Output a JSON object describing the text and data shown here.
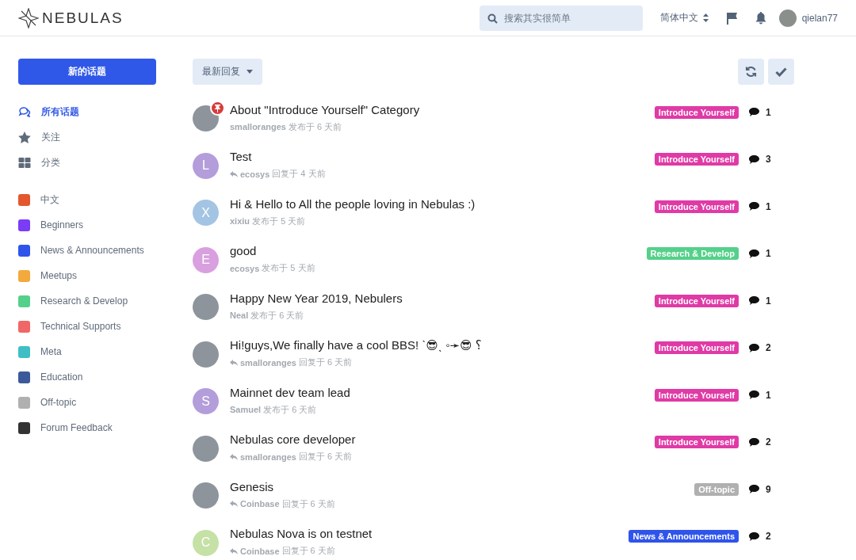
{
  "header": {
    "logo": "NEBULAS",
    "search": {
      "placeholder": "搜索其实很简单"
    },
    "language": "简体中文",
    "username": "qielan77"
  },
  "sidebar": {
    "new_topic": "新的话题",
    "nav": [
      {
        "label": "所有话题",
        "selected": true
      },
      {
        "label": "关注",
        "selected": false
      },
      {
        "label": "分类",
        "selected": false
      }
    ],
    "categories": [
      {
        "label": "中文",
        "color": "#e4572e"
      },
      {
        "label": "Beginners",
        "color": "#7a3cf5"
      },
      {
        "label": "News & Announcements",
        "color": "#2f54eb"
      },
      {
        "label": "Meetups",
        "color": "#f4a93c"
      },
      {
        "label": "Research & Develop",
        "color": "#55d08a"
      },
      {
        "label": "Technical Supports",
        "color": "#f06767"
      },
      {
        "label": "Meta",
        "color": "#3fbfc4"
      },
      {
        "label": "Education",
        "color": "#3c5a99"
      },
      {
        "label": "Off-topic",
        "color": "#b0b0b0"
      },
      {
        "label": "Forum Feedback",
        "color": "#333333"
      }
    ]
  },
  "toolbar": {
    "sort": "最新回复"
  },
  "topics": [
    {
      "title": "About \"Introduce Yourself\" Category",
      "avatar": {
        "kind": "image"
      },
      "pinned": true,
      "user": "smalloranges",
      "kind": "posted",
      "time": "发布于 6 天前",
      "tag": {
        "label": "Introduce Yourself",
        "color": "#e03aa6"
      },
      "replies": "1"
    },
    {
      "title": "Test",
      "avatar": {
        "kind": "letter",
        "letter": "L",
        "color": "#b39ddb"
      },
      "pinned": false,
      "user": "ecosys",
      "kind": "reply",
      "time": "回复于 4 天前",
      "tag": {
        "label": "Introduce Yourself",
        "color": "#e03aa6"
      },
      "replies": "3"
    },
    {
      "title": "Hi & Hello to All the people loving in Nebulas :)",
      "avatar": {
        "kind": "letter",
        "letter": "X",
        "color": "#a4c4e4"
      },
      "pinned": false,
      "user": "xixiu",
      "kind": "posted",
      "time": "发布于 5 天前",
      "tag": {
        "label": "Introduce Yourself",
        "color": "#e03aa6"
      },
      "replies": "1"
    },
    {
      "title": "good",
      "avatar": {
        "kind": "letter",
        "letter": "E",
        "color": "#d9a0e0"
      },
      "pinned": false,
      "user": "ecosys",
      "kind": "posted",
      "time": "发布于 5 天前",
      "tag": {
        "label": "Research & Develop",
        "color": "#55d08a"
      },
      "replies": "1"
    },
    {
      "title": "Happy New Year 2019, Nebulers",
      "avatar": {
        "kind": "image"
      },
      "pinned": false,
      "user": "Neal",
      "kind": "posted",
      "time": "发布于 6 天前",
      "tag": {
        "label": "Introduce Yourself",
        "color": "#e03aa6"
      },
      "replies": "1"
    },
    {
      "title": "Hi!guys,We finally have a cool BBS! ˋ😎ˎ ◦➛😎 ⸮",
      "avatar": {
        "kind": "image"
      },
      "pinned": false,
      "user": "smalloranges",
      "kind": "reply",
      "time": "回复于 6 天前",
      "tag": {
        "label": "Introduce Yourself",
        "color": "#e03aa6"
      },
      "replies": "2"
    },
    {
      "title": "Mainnet dev team lead",
      "avatar": {
        "kind": "letter",
        "letter": "S",
        "color": "#b39ddb"
      },
      "pinned": false,
      "user": "Samuel",
      "kind": "posted",
      "time": "发布于 6 天前",
      "tag": {
        "label": "Introduce Yourself",
        "color": "#e03aa6"
      },
      "replies": "1"
    },
    {
      "title": "Nebulas core developer",
      "avatar": {
        "kind": "image"
      },
      "pinned": false,
      "user": "smalloranges",
      "kind": "reply",
      "time": "回复于 6 天前",
      "tag": {
        "label": "Introduce Yourself",
        "color": "#e03aa6"
      },
      "replies": "2"
    },
    {
      "title": "Genesis",
      "avatar": {
        "kind": "image"
      },
      "pinned": false,
      "user": "Coinbase",
      "kind": "reply",
      "time": "回复于 6 天前",
      "tag": {
        "label": "Off-topic",
        "color": "#b0b0b0"
      },
      "replies": "9"
    },
    {
      "title": "Nebulas Nova is on testnet",
      "avatar": {
        "kind": "letter",
        "letter": "C",
        "color": "#c5e1a5"
      },
      "pinned": false,
      "user": "Coinbase",
      "kind": "reply",
      "time": "回复于 6 天前",
      "tag": {
        "label": "News & Announcements",
        "color": "#2f54eb"
      },
      "replies": "2"
    }
  ]
}
